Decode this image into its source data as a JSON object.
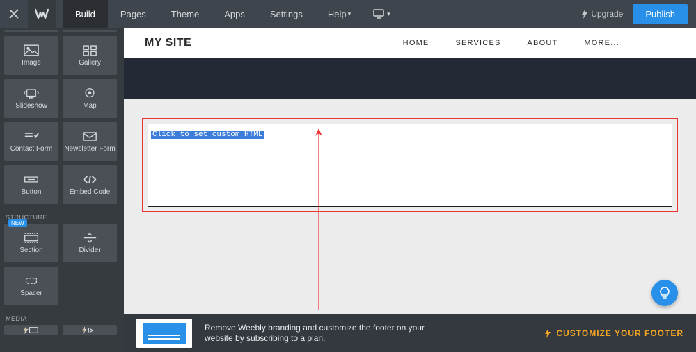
{
  "topbar": {
    "tabs": [
      "Build",
      "Pages",
      "Theme",
      "Apps",
      "Settings",
      "Help"
    ],
    "active_tab_index": 0,
    "upgrade_label": "Upgrade",
    "publish_label": "Publish"
  },
  "sidebar": {
    "tiles_row1": [
      {
        "label": "Image",
        "icon": "image"
      },
      {
        "label": "Gallery",
        "icon": "gallery"
      }
    ],
    "tiles_row2": [
      {
        "label": "Slideshow",
        "icon": "slideshow"
      },
      {
        "label": "Map",
        "icon": "map"
      }
    ],
    "tiles_row3": [
      {
        "label": "Contact Form",
        "icon": "contact"
      },
      {
        "label": "Newsletter Form",
        "icon": "newsletter"
      }
    ],
    "tiles_row4": [
      {
        "label": "Button",
        "icon": "button"
      },
      {
        "label": "Embed Code",
        "icon": "embed"
      }
    ],
    "category1": "STRUCTURE",
    "tiles_row5": [
      {
        "label": "Section",
        "icon": "section",
        "badge": "NEW"
      },
      {
        "label": "Divider",
        "icon": "divider"
      }
    ],
    "tiles_row6": [
      {
        "label": "Spacer",
        "icon": "spacer"
      }
    ],
    "category2": "MEDIA"
  },
  "site": {
    "title": "MY SITE",
    "nav": [
      "HOME",
      "SERVICES",
      "ABOUT",
      "MORE..."
    ]
  },
  "embed": {
    "placeholder_text": "Click to set custom HTML"
  },
  "footer": {
    "message_line1": "Remove Weebly branding and customize the footer on your",
    "message_line2": "website by subscribing to a plan.",
    "cta": "CUSTOMIZE YOUR FOOTER"
  }
}
